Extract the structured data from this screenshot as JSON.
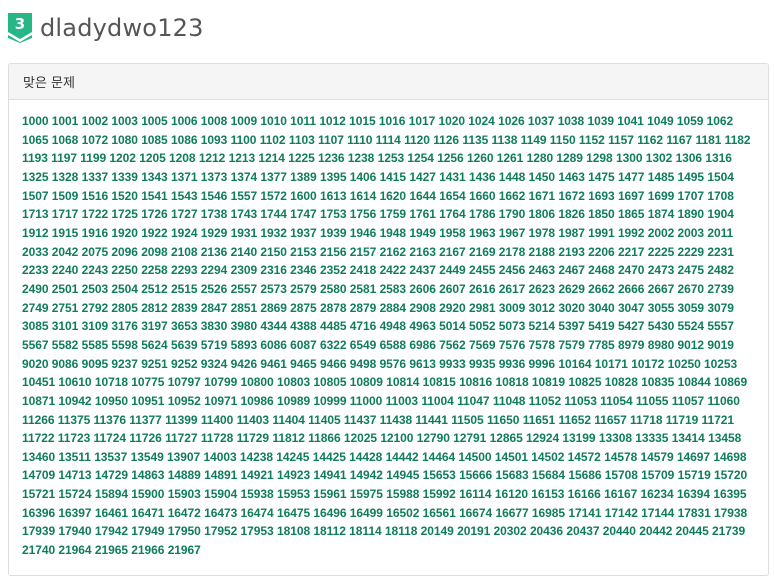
{
  "user": {
    "tier_badge_text": "3",
    "tier_color": "#27b787",
    "username": "dladydwo123"
  },
  "panel": {
    "heading": "맞은 문제"
  },
  "colors": {
    "problem_link": "#0f7d5c",
    "panel_heading_bg": "#f5f5f5",
    "border": "#dddddd"
  },
  "problems": [
    "1000",
    "1001",
    "1002",
    "1003",
    "1005",
    "1006",
    "1008",
    "1009",
    "1010",
    "1011",
    "1012",
    "1015",
    "1016",
    "1017",
    "1020",
    "1024",
    "1026",
    "1037",
    "1038",
    "1039",
    "1041",
    "1049",
    "1059",
    "1062",
    "1065",
    "1068",
    "1072",
    "1080",
    "1085",
    "1086",
    "1093",
    "1100",
    "1102",
    "1103",
    "1107",
    "1110",
    "1114",
    "1120",
    "1126",
    "1135",
    "1138",
    "1149",
    "1150",
    "1152",
    "1157",
    "1162",
    "1167",
    "1181",
    "1182",
    "1193",
    "1197",
    "1199",
    "1202",
    "1205",
    "1208",
    "1212",
    "1213",
    "1214",
    "1225",
    "1236",
    "1238",
    "1253",
    "1254",
    "1256",
    "1260",
    "1261",
    "1280",
    "1289",
    "1298",
    "1300",
    "1302",
    "1306",
    "1316",
    "1325",
    "1328",
    "1337",
    "1339",
    "1343",
    "1371",
    "1373",
    "1374",
    "1377",
    "1389",
    "1395",
    "1406",
    "1415",
    "1427",
    "1431",
    "1436",
    "1448",
    "1450",
    "1463",
    "1475",
    "1477",
    "1485",
    "1495",
    "1504",
    "1507",
    "1509",
    "1516",
    "1520",
    "1541",
    "1543",
    "1546",
    "1557",
    "1572",
    "1600",
    "1613",
    "1614",
    "1620",
    "1644",
    "1654",
    "1660",
    "1662",
    "1671",
    "1672",
    "1693",
    "1697",
    "1699",
    "1707",
    "1708",
    "1713",
    "1717",
    "1722",
    "1725",
    "1726",
    "1727",
    "1738",
    "1743",
    "1744",
    "1747",
    "1753",
    "1756",
    "1759",
    "1761",
    "1764",
    "1786",
    "1790",
    "1806",
    "1826",
    "1850",
    "1865",
    "1874",
    "1890",
    "1904",
    "1912",
    "1915",
    "1916",
    "1920",
    "1922",
    "1924",
    "1929",
    "1931",
    "1932",
    "1937",
    "1939",
    "1946",
    "1948",
    "1949",
    "1958",
    "1963",
    "1967",
    "1978",
    "1987",
    "1991",
    "1992",
    "2002",
    "2003",
    "2011",
    "2033",
    "2042",
    "2075",
    "2096",
    "2098",
    "2108",
    "2136",
    "2140",
    "2150",
    "2153",
    "2156",
    "2157",
    "2162",
    "2163",
    "2167",
    "2169",
    "2178",
    "2188",
    "2193",
    "2206",
    "2217",
    "2225",
    "2229",
    "2231",
    "2233",
    "2240",
    "2243",
    "2250",
    "2258",
    "2293",
    "2294",
    "2309",
    "2316",
    "2346",
    "2352",
    "2418",
    "2422",
    "2437",
    "2449",
    "2455",
    "2456",
    "2463",
    "2467",
    "2468",
    "2470",
    "2473",
    "2475",
    "2482",
    "2490",
    "2501",
    "2503",
    "2504",
    "2512",
    "2515",
    "2526",
    "2557",
    "2573",
    "2579",
    "2580",
    "2581",
    "2583",
    "2606",
    "2607",
    "2616",
    "2617",
    "2623",
    "2629",
    "2662",
    "2666",
    "2667",
    "2670",
    "2739",
    "2749",
    "2751",
    "2792",
    "2805",
    "2812",
    "2839",
    "2847",
    "2851",
    "2869",
    "2875",
    "2878",
    "2879",
    "2884",
    "2908",
    "2920",
    "2981",
    "3009",
    "3012",
    "3020",
    "3040",
    "3047",
    "3055",
    "3059",
    "3079",
    "3085",
    "3101",
    "3109",
    "3176",
    "3197",
    "3653",
    "3830",
    "3980",
    "4344",
    "4388",
    "4485",
    "4716",
    "4948",
    "4963",
    "5014",
    "5052",
    "5073",
    "5214",
    "5397",
    "5419",
    "5427",
    "5430",
    "5524",
    "5557",
    "5567",
    "5582",
    "5585",
    "5598",
    "5624",
    "5639",
    "5719",
    "5893",
    "6086",
    "6087",
    "6322",
    "6549",
    "6588",
    "6986",
    "7562",
    "7569",
    "7576",
    "7578",
    "7579",
    "7785",
    "8979",
    "8980",
    "9012",
    "9019",
    "9020",
    "9086",
    "9095",
    "9237",
    "9251",
    "9252",
    "9324",
    "9426",
    "9461",
    "9465",
    "9466",
    "9498",
    "9576",
    "9613",
    "9933",
    "9935",
    "9936",
    "9996",
    "10164",
    "10171",
    "10172",
    "10250",
    "10253",
    "10451",
    "10610",
    "10718",
    "10775",
    "10797",
    "10799",
    "10800",
    "10803",
    "10805",
    "10809",
    "10814",
    "10815",
    "10816",
    "10818",
    "10819",
    "10825",
    "10828",
    "10835",
    "10844",
    "10869",
    "10871",
    "10942",
    "10950",
    "10951",
    "10952",
    "10971",
    "10986",
    "10989",
    "10999",
    "11000",
    "11003",
    "11004",
    "11047",
    "11048",
    "11052",
    "11053",
    "11054",
    "11055",
    "11057",
    "11060",
    "11266",
    "11375",
    "11376",
    "11377",
    "11399",
    "11400",
    "11403",
    "11404",
    "11405",
    "11437",
    "11438",
    "11441",
    "11505",
    "11650",
    "11651",
    "11652",
    "11657",
    "11718",
    "11719",
    "11721",
    "11722",
    "11723",
    "11724",
    "11726",
    "11727",
    "11728",
    "11729",
    "11812",
    "11866",
    "12025",
    "12100",
    "12790",
    "12791",
    "12865",
    "12924",
    "13199",
    "13308",
    "13335",
    "13414",
    "13458",
    "13460",
    "13511",
    "13537",
    "13549",
    "13907",
    "14003",
    "14238",
    "14245",
    "14425",
    "14428",
    "14442",
    "14464",
    "14500",
    "14501",
    "14502",
    "14572",
    "14578",
    "14579",
    "14697",
    "14698",
    "14709",
    "14713",
    "14729",
    "14863",
    "14889",
    "14891",
    "14921",
    "14923",
    "14941",
    "14942",
    "14945",
    "15653",
    "15666",
    "15683",
    "15684",
    "15686",
    "15708",
    "15709",
    "15719",
    "15720",
    "15721",
    "15724",
    "15894",
    "15900",
    "15903",
    "15904",
    "15938",
    "15953",
    "15961",
    "15975",
    "15988",
    "15992",
    "16114",
    "16120",
    "16153",
    "16166",
    "16167",
    "16234",
    "16394",
    "16395",
    "16396",
    "16397",
    "16461",
    "16471",
    "16472",
    "16473",
    "16474",
    "16475",
    "16496",
    "16499",
    "16502",
    "16561",
    "16674",
    "16677",
    "16985",
    "17141",
    "17142",
    "17144",
    "17831",
    "17938",
    "17939",
    "17940",
    "17942",
    "17949",
    "17950",
    "17952",
    "17953",
    "18108",
    "18112",
    "18114",
    "18118",
    "20149",
    "20191",
    "20302",
    "20436",
    "20437",
    "20440",
    "20442",
    "20445",
    "21739",
    "21740",
    "21964",
    "21965",
    "21966",
    "21967"
  ]
}
